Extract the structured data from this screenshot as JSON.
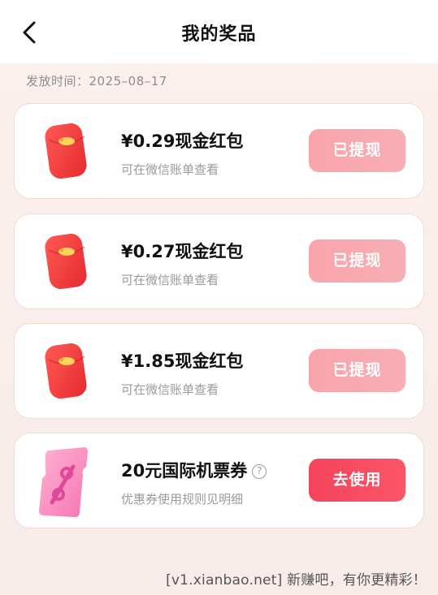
{
  "header": {
    "title": "我的奖品",
    "back_icon": "chevron-left-icon"
  },
  "issue_date": "发放时间：2025–08–17",
  "prizes": [
    {
      "title": "¥0.29现金红包",
      "subtitle": "可在微信账单查看",
      "button": "已提现",
      "icon": "red-envelope-icon"
    },
    {
      "title": "¥0.27现金红包",
      "subtitle": "可在微信账单查看",
      "button": "已提现",
      "icon": "red-envelope-icon"
    },
    {
      "title": "¥1.85现金红包",
      "subtitle": "可在微信账单查看",
      "button": "已提现",
      "icon": "red-envelope-icon"
    },
    {
      "title": "20元国际机票券",
      "subtitle": "优惠券使用规则见明细",
      "button": "去使用",
      "icon": "coupon-ticket-icon",
      "help_icon": "?"
    }
  ],
  "colors": {
    "done_button": "#f9a4aa",
    "use_button": "#f4445d",
    "page_background": "#fbf0ee",
    "card_border": "#f3dccb"
  },
  "watermark": "[v1.xianbao.net] 新赚吧，有你更精彩！"
}
